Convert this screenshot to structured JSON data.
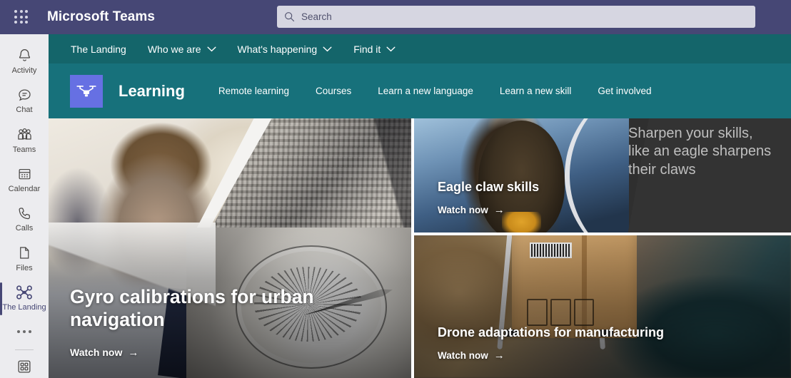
{
  "titlebar": {
    "app_title": "Microsoft Teams",
    "waffle_icon": "app-launcher-grid-icon",
    "search": {
      "icon": "search-icon",
      "placeholder": "Search",
      "value": ""
    }
  },
  "rail": {
    "items": [
      {
        "label": "Activity",
        "icon": "bell-icon",
        "active": false
      },
      {
        "label": "Chat",
        "icon": "chat-icon",
        "active": false
      },
      {
        "label": "Teams",
        "icon": "people-icon",
        "active": false
      },
      {
        "label": "Calendar",
        "icon": "calendar-icon",
        "active": false
      },
      {
        "label": "Calls",
        "icon": "phone-icon",
        "active": false
      },
      {
        "label": "Files",
        "icon": "file-icon",
        "active": false
      },
      {
        "label": "The Landing",
        "icon": "drone-icon",
        "active": true
      }
    ],
    "more_icon": "more-ellipsis-icon",
    "apps_icon": "apps-grid-icon",
    "accent_color": "#464775"
  },
  "navstrip": {
    "items": [
      {
        "label": "The Landing",
        "has_chevron": false
      },
      {
        "label": "Who we are",
        "has_chevron": true
      },
      {
        "label": "What's happening",
        "has_chevron": true
      },
      {
        "label": "Find it",
        "has_chevron": true
      }
    ],
    "chevron_icon": "chevron-down-icon",
    "background_color": "#14656a"
  },
  "learning_band": {
    "logo_icon": "drone-logo-icon",
    "logo_background": "#6670e3",
    "site_title": "Learning",
    "background_color": "#17717b",
    "links": [
      {
        "label": "Remote learning"
      },
      {
        "label": "Courses"
      },
      {
        "label": "Learn a new language"
      },
      {
        "label": "Learn a new skill"
      },
      {
        "label": "Get involved"
      }
    ]
  },
  "cards": {
    "hero": {
      "title": "Gyro calibrations for urban navigation",
      "cta": "Watch now",
      "cta_icon": "arrow-right-icon",
      "image_alt": "student-in-safety-goggles-city-aerial-compass-collage"
    },
    "eagle": {
      "title": "Eagle claw skills",
      "cta": "Watch now",
      "cta_icon": "arrow-right-icon",
      "quote": "Sharpen your skills, like an eagle sharpens their claws",
      "panel_color": "#333333",
      "image_alt": "bald-eagle-perched"
    },
    "drone": {
      "title": "Drone adaptations for manufacturing",
      "cta": "Watch now",
      "cta_icon": "arrow-right-icon",
      "image_alt": "drone-carrying-cardboard-package"
    }
  }
}
